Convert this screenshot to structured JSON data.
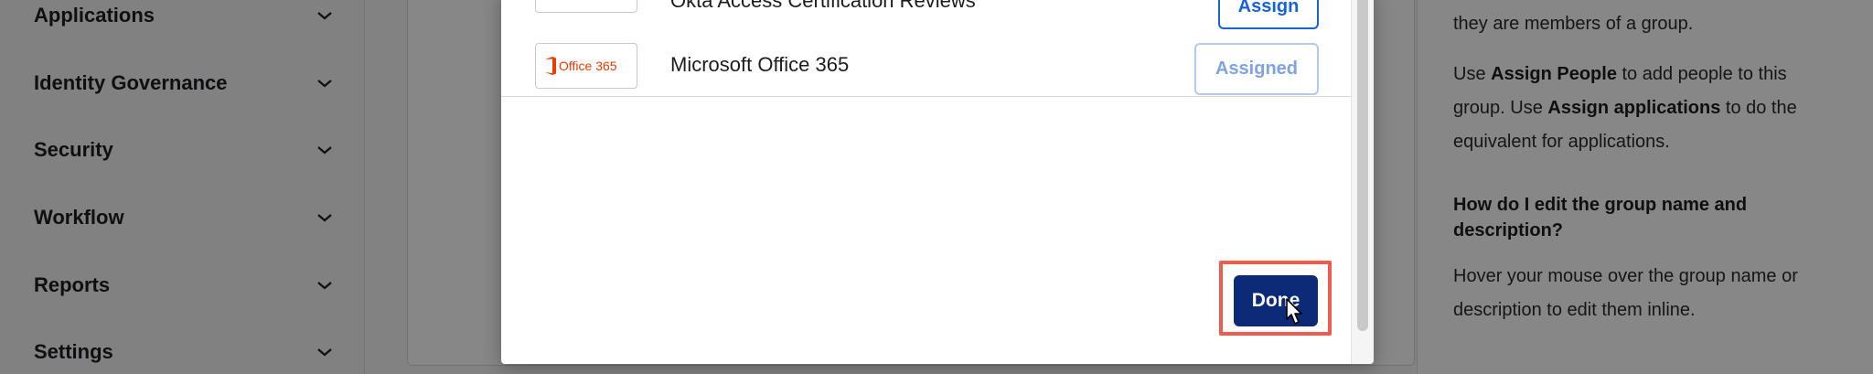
{
  "sidebar": {
    "items": [
      {
        "label": "Applications"
      },
      {
        "label": "Identity Governance"
      },
      {
        "label": "Security"
      },
      {
        "label": "Workflow"
      },
      {
        "label": "Reports"
      },
      {
        "label": "Settings"
      }
    ]
  },
  "help": {
    "top_fragment": "they are members of a group.",
    "para1_a": "Use ",
    "para1_b": "Assign People",
    "para1_c": " to add people to this group. Use ",
    "para1_d": "Assign applications",
    "para1_e": " to do the equivalent for applications.",
    "question": "How do I edit the group name and description?",
    "answer": "Hover your mouse over the group name or description to edit them inline."
  },
  "modal": {
    "apps": [
      {
        "name": "Okta Access Certification Reviews",
        "button": "Assign",
        "state": "assign"
      },
      {
        "name": "Microsoft Office 365",
        "button": "Assigned",
        "state": "assigned",
        "logo_text": "Office 365"
      }
    ],
    "done_label": "Done"
  },
  "colors": {
    "primary": "#1662dd",
    "done_bg": "#0d2a78",
    "highlight": "#ef5b4d",
    "office_red": "#eb3c00"
  }
}
